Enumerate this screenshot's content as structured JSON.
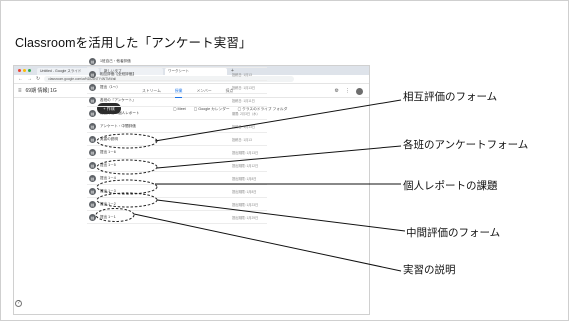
{
  "slide": {
    "title": "Classroomを活用した「アンケート実習」",
    "help_icon": "question-circle-icon"
  },
  "browser": {
    "dot_colors": [
      "#ea4335",
      "#fbbc05",
      "#34a853"
    ],
    "tabs": [
      {
        "label": "Untitled - Google スライド",
        "active": false
      },
      {
        "label": "新しいタブ",
        "active": false
      },
      {
        "label": "ワークシート",
        "active": true
      }
    ],
    "new_tab": "+",
    "url": "classroom.google.com/w/NDU3NTY4NTM/t/all",
    "nav_icons": [
      "back-icon",
      "forward-icon",
      "reload-icon"
    ]
  },
  "classroom": {
    "menu_icon": "≡",
    "course_name": "69期 情報| 1G",
    "tabs": [
      "ストリーム",
      "授業",
      "メンバー",
      "採点"
    ],
    "active_tab_index": 1,
    "create_button": "+ 作成",
    "links": [
      "▢ Meet",
      "▢ Google カレンダー",
      "▢ クラスのドライブ フォルダ"
    ],
    "items": [
      {
        "title": "1班自己・他者評価",
        "date": ""
      },
      {
        "title": "相互評価【全班評価】",
        "date": "投稿日: 1月13"
      },
      {
        "title": "提出（1～）",
        "date": "投稿日: 1月13日"
      },
      {
        "title": "各班の『アンケート』",
        "date": "投稿日: 1月11日"
      },
      {
        "title": "報告作成・個人レポート",
        "date": "期限: 2月3日（水）"
      },
      {
        "title": "アンケート・中間評価",
        "date": "投稿日: 1月13日"
      },
      {
        "title": "実習の説明",
        "date": "投稿日: 1月13"
      },
      {
        "title": "提出 1－6",
        "date": "提出期限: 1月13日"
      },
      {
        "title": "提出 1－5",
        "date": "提出期限: 1月12日"
      },
      {
        "title": "提出 1－4",
        "date": "提出期限: 1月8日"
      },
      {
        "title": "提出 1－3",
        "date": "提出期限: 1月8日"
      },
      {
        "title": "提出 1－2",
        "date": "提出期限: 1月23日"
      },
      {
        "title": "提出 1－1",
        "date": "提出期限: 1月29日"
      }
    ]
  },
  "callouts": [
    {
      "label": "相互評価のフォーム"
    },
    {
      "label": "各班のアンケートフォーム"
    },
    {
      "label": "個人レポートの課題"
    },
    {
      "label": "中間評価のフォーム"
    },
    {
      "label": "実習の説明"
    }
  ]
}
